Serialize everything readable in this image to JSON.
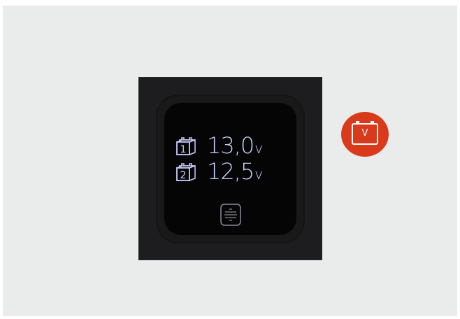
{
  "display": {
    "battery_1": {
      "label": "1",
      "voltage": "13,0",
      "unit": "v"
    },
    "battery_2": {
      "label": "2",
      "voltage": "12,5",
      "unit": "v"
    },
    "screen_text_color": "#c9ccff",
    "menu_button_icon": "menu-icon"
  },
  "badge": {
    "label": "V",
    "icon": "battery-icon",
    "color": "#d83a1b"
  }
}
